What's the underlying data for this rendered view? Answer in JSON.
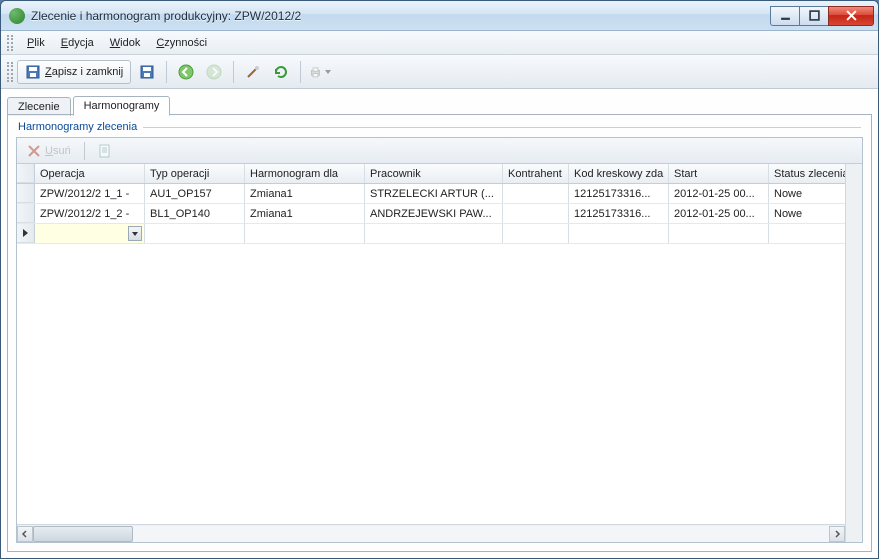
{
  "window": {
    "title": "Zlecenie i harmonogram produkcyjny: ZPW/2012/2"
  },
  "menu": {
    "plik": "Plik",
    "edycja": "Edycja",
    "widok": "Widok",
    "czynnosci": "Czynności"
  },
  "toolbar": {
    "save_close": "Zapisz i zamknij"
  },
  "tabs": {
    "zlecenie": "Zlecenie",
    "harmonogramy": "Harmonogramy"
  },
  "group": {
    "legend": "Harmonogramy zlecenia",
    "delete": "Usuń"
  },
  "grid": {
    "headers": {
      "operacja": "Operacja",
      "typ_operacji": "Typ operacji",
      "harmonogram_dla": "Harmonogram dla",
      "pracownik": "Pracownik",
      "kontrahent": "Kontrahent",
      "kod_kreskowy": "Kod kreskowy zda",
      "start": "Start",
      "status": "Status zlecenia"
    },
    "rows": [
      {
        "operacja": "ZPW/2012/2 1_1 -",
        "typ_operacji": "AU1_OP157",
        "harmonogram_dla": "Zmiana1",
        "pracownik": "STRZELECKI ARTUR (...",
        "kontrahent": "",
        "kod_kreskowy": "12125173316...",
        "start": "2012-01-25 00...",
        "status": "Nowe"
      },
      {
        "operacja": "ZPW/2012/2 1_2 -",
        "typ_operacji": "BL1_OP140",
        "harmonogram_dla": "Zmiana1",
        "pracownik": "ANDRZEJEWSKI PAW...",
        "kontrahent": "",
        "kod_kreskowy": "12125173316...",
        "start": "2012-01-25 00...",
        "status": "Nowe"
      }
    ]
  }
}
